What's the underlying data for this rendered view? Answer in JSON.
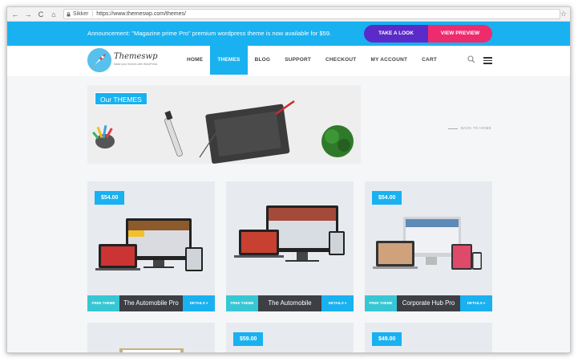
{
  "browser": {
    "secure_label": "Sikker",
    "url": "https://www.themeswp.com/themes/",
    "back_glyph": "←",
    "forward_glyph": "→",
    "reload_glyph": "C",
    "home_glyph": "⌂",
    "lock_glyph": "🔒",
    "star_glyph": "☆"
  },
  "announcement": {
    "text": "Announcement: \"Magazine prime Pro\" premium wordpress theme is now available for $59.",
    "look_label": "TAKE A LOOK",
    "preview_label": "VIEW PREVIEW"
  },
  "header": {
    "brand": "Themeswp",
    "tagline": "Make your themes with WordPress",
    "menu": [
      {
        "label": "HOME"
      },
      {
        "label": "THEMES",
        "active": true
      },
      {
        "label": "BLOG"
      },
      {
        "label": "SUPPORT"
      },
      {
        "label": "CHECKOUT"
      },
      {
        "label": "MY ACCOUNT"
      },
      {
        "label": "CART"
      }
    ]
  },
  "hero": {
    "tag": "Our THEMES",
    "back_label": "BACK TO HOME"
  },
  "cards": [
    {
      "price": "$54.00",
      "free": "FREE THEME",
      "name": "The Automobile Pro",
      "details": "DETAILS ▾"
    },
    {
      "price": "",
      "free": "FREE THEME",
      "name": "The Automobile",
      "details": "DETAILS ▾"
    },
    {
      "price": "$54.00",
      "free": "FREE THEME",
      "name": "Corporate Hub Pro",
      "details": "DETAILS ▾"
    },
    {
      "price": ""
    },
    {
      "price": "$59.00"
    },
    {
      "price": "$49.00"
    }
  ],
  "colors": {
    "accent": "#19b1f0",
    "look_button": "#5b2bc9",
    "preview_button": "#ee2b6c",
    "free_tag": "#37c7d4",
    "name_bar": "#3d3f45"
  }
}
